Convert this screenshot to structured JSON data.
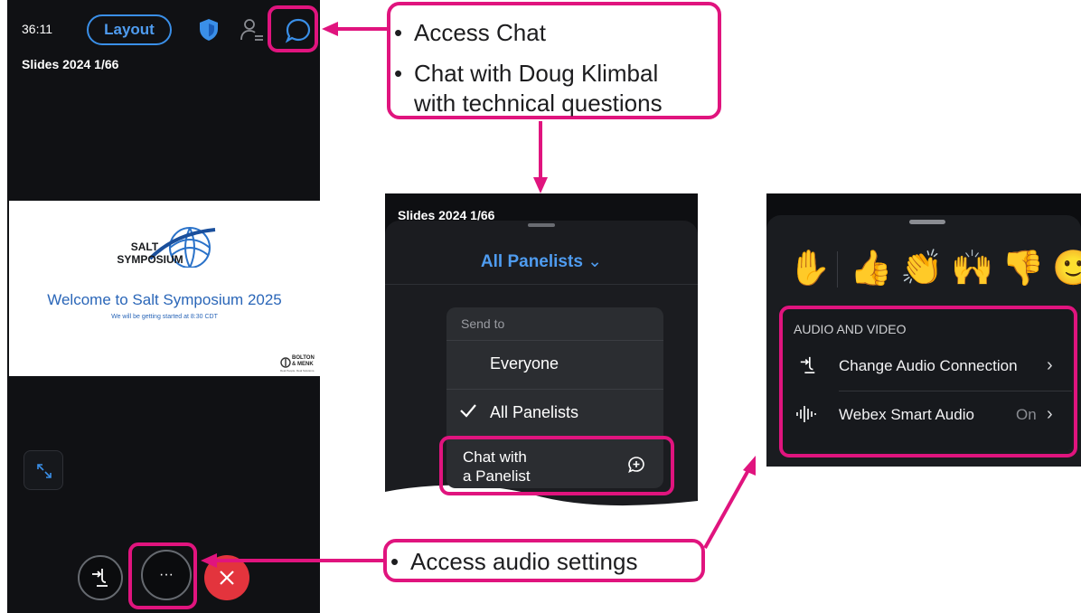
{
  "phone": {
    "time": "36:11",
    "layout_label": "Layout",
    "slides_tag": "Slides 2024  1/66",
    "slide": {
      "logo_line1": "SALT",
      "logo_line2": "SYMPOSIUM",
      "headline": "Welcome to Salt Symposium 2025",
      "subline": "We will be getting started at 8:30 CDT",
      "corner_logo_line1": "BOLTON",
      "corner_logo_line2": "& MENK",
      "corner_logo_tagline": "Real People. Real Solutions."
    },
    "more_label": "···",
    "icons": [
      "shield-icon",
      "participants-icon",
      "chat-bubble-icon",
      "expand-icon",
      "audio-connection-icon",
      "more-icon",
      "end-call-icon"
    ]
  },
  "callouts": {
    "chat_item1": "Access Chat",
    "chat_item2_line1": "Chat with Doug Klimbal",
    "chat_item2_line2": "with technical questions",
    "audio_item": "Access audio settings"
  },
  "chat_panel": {
    "slides_tag": "Slides 2024  1/66",
    "title": "All Panelists",
    "send_to_label": "Send to",
    "options": [
      "Everyone",
      "All Panelists"
    ],
    "selected": "All Panelists",
    "chat_with_line1": "Chat with",
    "chat_with_line2": "a Panelist"
  },
  "audio_panel": {
    "reactions": [
      "✋",
      "👍",
      "👏",
      "🙌",
      "👎",
      "🙂"
    ],
    "section_title": "AUDIO AND VIDEO",
    "rows": [
      {
        "label": "Change Audio Connection",
        "value": ""
      },
      {
        "label": "Webex Smart Audio",
        "value": "On"
      }
    ]
  },
  "colors": {
    "annotation": "#e0147e",
    "accent_blue": "#4f9cf0",
    "end_call_red": "#e3343d",
    "phone_bg": "#101114"
  }
}
